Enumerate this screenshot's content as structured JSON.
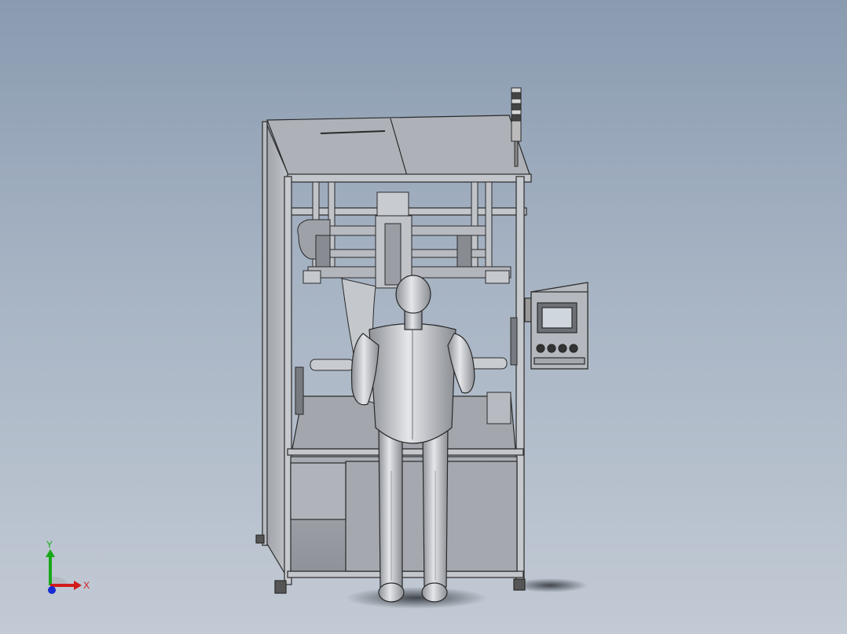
{
  "viewport": {
    "background_top": "#8a9bb0",
    "background_bottom": "#c2cad4"
  },
  "model": {
    "frame_color": "#b9bdc3",
    "panel_color": "#9fa3a9",
    "edge_color": "#2a2a2a",
    "mannequin_color": "#c9ccd2",
    "screen_color": "#cfd6de"
  },
  "triad": {
    "x_label": "X",
    "y_label": "Y",
    "x_color": "#d21a1a",
    "y_color": "#17a817",
    "z_color": "#1a2ad2"
  }
}
